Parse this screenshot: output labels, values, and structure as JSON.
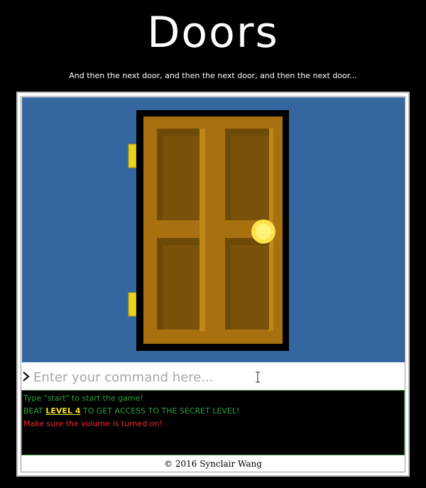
{
  "game": {
    "title": "Doors",
    "subtitle": "And then the next door, and then the next door, and then the next door...",
    "command_input": {
      "placeholder": "Enter your command here...",
      "value": ""
    },
    "console": {
      "line1": "Type \"start\" to start the game!",
      "line2_prefix": "BEAT ",
      "line2_level": "LEVEL 4",
      "line2_suffix": " TO GET ACCESS TO THE SECRET LEVEL!",
      "line3": "Make sure the volume is turned on!"
    },
    "footer": "© 2016 Synclair Wang"
  },
  "icons": [
    "prompt-chevron-icon",
    "text-cursor-icon",
    "door-knob-icon",
    "hinge-icon"
  ],
  "colors": {
    "page_background": "#000000",
    "scene_background": "#3467a0",
    "door_wood": "#a9700f",
    "door_panel": "#6e4a07",
    "door_frame": "#000000",
    "hinge": "#e8d21a",
    "knob": "#fff06b",
    "console_green": "#2fa13a",
    "console_red": "#f0262b",
    "console_highlight": "#f2e21d"
  }
}
